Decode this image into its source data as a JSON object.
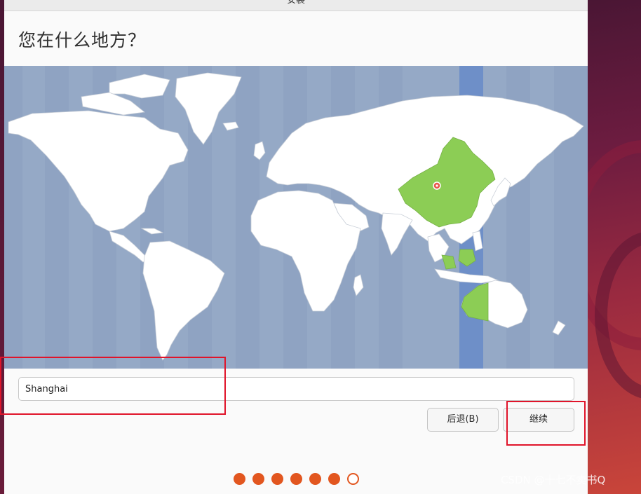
{
  "window": {
    "title": "安装"
  },
  "page": {
    "title": "您在什么地方？"
  },
  "map": {
    "selected_timezone_region": "Asia/Shanghai",
    "ocean_color": "#95a9c6",
    "land_color": "#ffffff",
    "highlight_color": "#8ccd55",
    "timezone_band_color": "#6e8fc8",
    "marker_color": "#e8574a"
  },
  "location": {
    "value": "Shanghai"
  },
  "buttons": {
    "back": "后退(B)",
    "continue": "继续"
  },
  "progress": {
    "total_steps": 7,
    "completed_steps": 6,
    "accent": "#e2561f"
  },
  "watermark": "CSDN @十七不卖书Q"
}
